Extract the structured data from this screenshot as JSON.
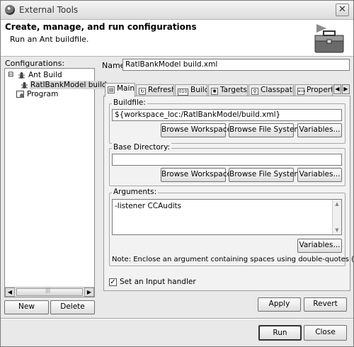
{
  "window": {
    "title": "External Tools",
    "close_glyph": "✕"
  },
  "banner": {
    "heading": "Create, manage, and run configurations",
    "subtitle": "Run an Ant buildfile.",
    "icon": "toolbox-icon"
  },
  "left": {
    "label": "Configurations:",
    "tree": [
      {
        "label": "Ant Build",
        "icon": "ant-icon",
        "expander": "⊟"
      },
      {
        "label": "RatlBankModel build",
        "icon": "ant-file-icon",
        "selected": true
      },
      {
        "label": "Program",
        "icon": "program-icon"
      }
    ],
    "new_label": "New",
    "delete_label": "Delete",
    "scroll_left": "◀",
    "scroll_right": "▶",
    "scroll_grip": "|||"
  },
  "name": {
    "label": "Name:",
    "value": "RatlBankModel build.xml"
  },
  "tabs": [
    {
      "label": "Main",
      "icon_glyph": "▤",
      "active": true
    },
    {
      "label": "Refresh",
      "icon_glyph": "↻"
    },
    {
      "label": "Build",
      "icon_glyph": "010"
    },
    {
      "label": "Targets",
      "icon_glyph": "✱"
    },
    {
      "label": "Classpath",
      "icon_glyph": "⚲"
    },
    {
      "label": "Properties",
      "icon_glyph": "⟷"
    }
  ],
  "tab_scroll": {
    "left": "◀",
    "right": "▶"
  },
  "buildfile": {
    "label": "Buildfile:",
    "value": "${workspace_loc:/RatlBankModel/build.xml}",
    "browse_workspace": "Browse Workspace...",
    "browse_fs": "Browse File System...",
    "variables": "Variables..."
  },
  "basedir": {
    "label": "Base Directory:",
    "value": "",
    "browse_workspace": "Browse Workspace...",
    "browse_fs": "Browse File System...",
    "variables": "Variables..."
  },
  "arguments": {
    "label": "Arguments:",
    "value": "-listener CCAudits",
    "variables": "Variables...",
    "note": "Note: Enclose an argument containing spaces using double-quotes (\")."
  },
  "input_handler": {
    "label": "Set an Input handler",
    "checked": true,
    "check_glyph": "✓"
  },
  "apply_label": "Apply",
  "revert_label": "Revert",
  "run_label": "Run",
  "close_label": "Close"
}
